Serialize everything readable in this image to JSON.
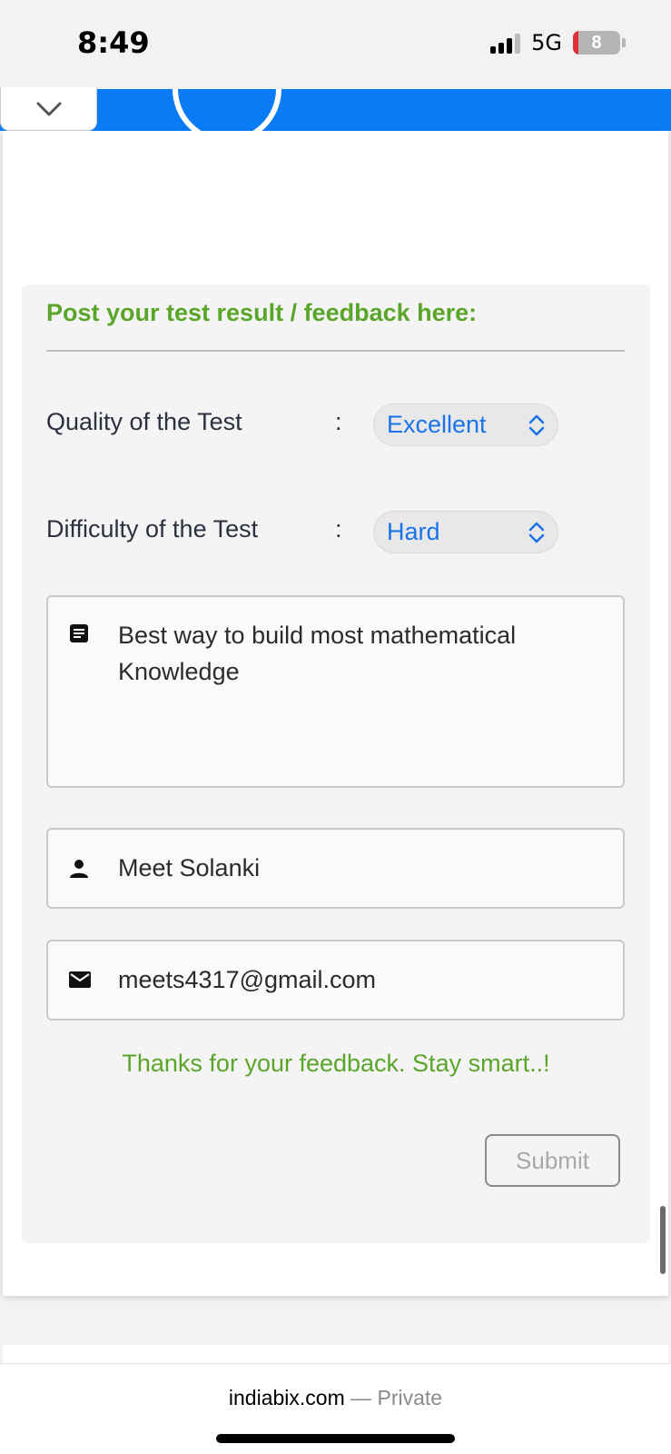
{
  "status": {
    "time": "8:49",
    "network": "5G",
    "battery": "8"
  },
  "form": {
    "title": "Post your test result / feedback here:",
    "quality": {
      "label": "Quality of the Test",
      "colon": ":",
      "value": "Excellent"
    },
    "difficulty": {
      "label": "Difficulty of the Test",
      "colon": ":",
      "value": "Hard"
    },
    "comment": {
      "line1": "Best way to build most mathematical",
      "line2": "Knowledge"
    },
    "name": {
      "value": "Meet Solanki"
    },
    "email": {
      "value": "meets4317@gmail.com"
    },
    "thanks": "Thanks for your feedback. Stay smart..!",
    "submit_label": "Submit"
  },
  "browser": {
    "domain": "indiabix.com",
    "mode": " — Private"
  },
  "colors": {
    "accent_green": "#5aa62a",
    "link_blue": "#1a73e8",
    "header_blue": "#0b7bf5"
  }
}
